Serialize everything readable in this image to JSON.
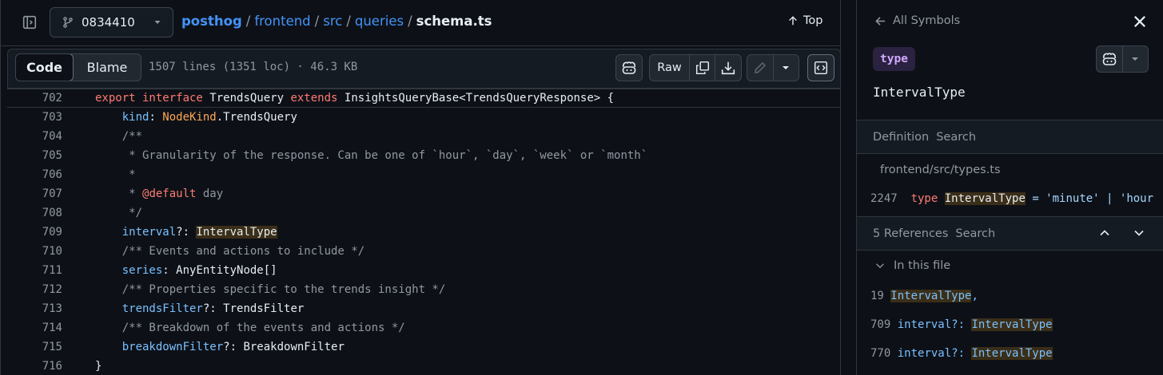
{
  "header": {
    "branch": "0834410",
    "breadcrumb": {
      "repo": "posthog",
      "path": [
        "frontend",
        "src",
        "queries"
      ],
      "file": "schema.ts",
      "separator": "/"
    },
    "top_label": "Top"
  },
  "filebar": {
    "tabs": [
      "Code",
      "Blame"
    ],
    "meta": "1507 lines (1351 loc) · 46.3 KB",
    "raw_label": "Raw"
  },
  "code": {
    "lines": [
      {
        "n": "702",
        "text": "export interface TrendsQuery extends InsightsQueryBase<TrendsQueryResponse> {"
      },
      {
        "n": "703",
        "text": "    kind: NodeKind.TrendsQuery"
      },
      {
        "n": "704",
        "text": "    /**"
      },
      {
        "n": "705",
        "text": "     * Granularity of the response. Can be one of `hour`, `day`, `week` or `month`"
      },
      {
        "n": "706",
        "text": "     *"
      },
      {
        "n": "707",
        "text": "     * @default day"
      },
      {
        "n": "708",
        "text": "     */"
      },
      {
        "n": "709",
        "text": "    interval?: IntervalType"
      },
      {
        "n": "710",
        "text": "    /** Events and actions to include */"
      },
      {
        "n": "711",
        "text": "    series: AnyEntityNode[]"
      },
      {
        "n": "712",
        "text": "    /** Properties specific to the trends insight */"
      },
      {
        "n": "713",
        "text": "    trendsFilter?: TrendsFilter"
      },
      {
        "n": "714",
        "text": "    /** Breakdown of the events and actions */"
      },
      {
        "n": "715",
        "text": "    breakdownFilter?: BreakdownFilter"
      },
      {
        "n": "716",
        "text": "}"
      }
    ]
  },
  "panel": {
    "back_label": "All Symbols",
    "kind_badge": "type",
    "symbol_name": "IntervalType",
    "definition": {
      "tabs": [
        "Definition",
        "Search"
      ],
      "path": "frontend/src/types.ts",
      "line_no": "2247",
      "keyword": "type",
      "name": "IntervalType",
      "rest": " = 'minute' | 'hour"
    },
    "references": {
      "count_label": "5 References",
      "search_label": "Search",
      "group_label": "In this file",
      "rows": [
        {
          "n": "19",
          "before": "",
          "match": "IntervalType",
          "after": ","
        },
        {
          "n": "709",
          "before": "interval?: ",
          "match": "IntervalType",
          "after": ""
        },
        {
          "n": "770",
          "before": "interval?: ",
          "match": "IntervalType",
          "after": ""
        }
      ]
    }
  },
  "colors": {
    "background": "#0d1117",
    "link": "#4493f8",
    "keyword": "#ff7b72",
    "property": "#79c0ff",
    "comment": "#9198a1",
    "constant": "#ffa657",
    "symbol_highlight": "#3b2e18",
    "badge": "#d2a8ff"
  },
  "icons": [
    "sidebar-toggle-icon",
    "git-branch-icon",
    "chevron-down-icon",
    "arrow-up-icon",
    "copilot-icon",
    "copy-icon",
    "download-icon",
    "pencil-icon",
    "code-square-icon",
    "arrow-left-icon",
    "close-icon",
    "chevron-up-icon"
  ]
}
